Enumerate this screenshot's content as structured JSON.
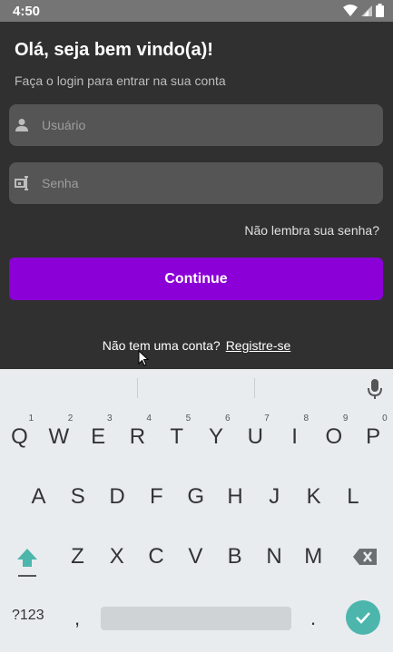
{
  "status_bar": {
    "time": "4:50"
  },
  "login": {
    "title": "Olá, seja bem vindo(a)!",
    "subtitle": "Faça o login para entrar na sua conta",
    "username_placeholder": "Usuário",
    "password_placeholder": "Senha",
    "forgot_password": "Não lembra sua senha?",
    "continue_label": "Continue",
    "no_account": "Não tem uma conta?",
    "register_link": "Registre-se"
  },
  "keyboard": {
    "row1": [
      {
        "key": "Q",
        "hint": "1"
      },
      {
        "key": "W",
        "hint": "2"
      },
      {
        "key": "E",
        "hint": "3"
      },
      {
        "key": "R",
        "hint": "4"
      },
      {
        "key": "T",
        "hint": "5"
      },
      {
        "key": "Y",
        "hint": "6"
      },
      {
        "key": "U",
        "hint": "7"
      },
      {
        "key": "I",
        "hint": "8"
      },
      {
        "key": "O",
        "hint": "9"
      },
      {
        "key": "P",
        "hint": "0"
      }
    ],
    "row2": [
      "A",
      "S",
      "D",
      "F",
      "G",
      "H",
      "J",
      "K",
      "L"
    ],
    "row3": [
      "Z",
      "X",
      "C",
      "V",
      "B",
      "N",
      "M"
    ],
    "symbols_label": "?123",
    "comma": ",",
    "period": "."
  },
  "colors": {
    "accent": "#8b00d6",
    "enter": "#4db6ac",
    "shift": "#4db6ac"
  }
}
